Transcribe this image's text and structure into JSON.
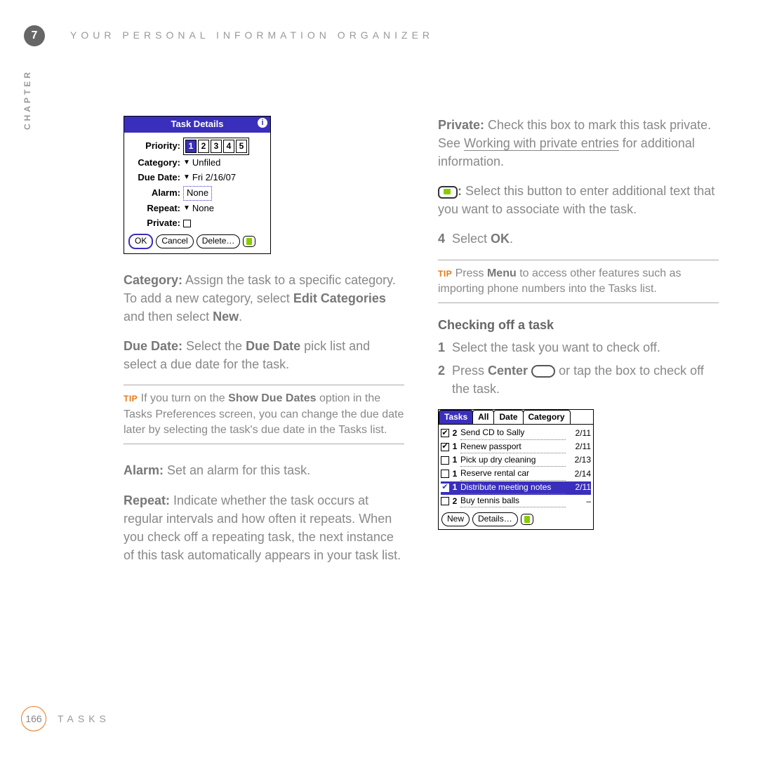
{
  "header": {
    "chapter_num": "7",
    "title": "YOUR PERSONAL INFORMATION ORGANIZER",
    "chapter_word": "CHAPTER"
  },
  "footer": {
    "page_num": "166",
    "section": "TASKS"
  },
  "dialog": {
    "title": "Task Details",
    "priority_label": "Priority:",
    "priority_options": [
      "1",
      "2",
      "3",
      "4",
      "5"
    ],
    "priority_selected": "1",
    "category_label": "Category:",
    "category_value": "Unfiled",
    "duedate_label": "Due Date:",
    "duedate_value": "Fri 2/16/07",
    "alarm_label": "Alarm:",
    "alarm_value": "None",
    "repeat_label": "Repeat:",
    "repeat_value": "None",
    "private_label": "Private:",
    "ok": "OK",
    "cancel": "Cancel",
    "delete": "Delete…"
  },
  "left": {
    "p1_bold": "Category:",
    "p1_rest": " Assign the task to a specific category. To add a new category, select ",
    "p1_bold2": "Edit Categories",
    "p1_mid": " and then select ",
    "p1_bold3": "New",
    "p1_end": ".",
    "p2_bold": "Due Date:",
    "p2_mid": " Select the ",
    "p2_bold2": "Due Date",
    "p2_rest": " pick list and select a due date for the task.",
    "tip_prefix": "TIP",
    "tip_text1": " If you turn on the ",
    "tip_bold": "Show Due Dates",
    "tip_text2": " option in the Tasks Preferences screen, you can change the due date later by selecting the task's due date in the Tasks list.",
    "p3_bold": "Alarm:",
    "p3_rest": " Set an alarm for this task.",
    "p4_bold": "Repeat:",
    "p4_rest": " Indicate whether the task occurs at regular intervals and how often it repeats. When you check off a repeating task, the next instance of this task automatically appears in your task list."
  },
  "right": {
    "p1_bold": "Private:",
    "p1_text": " Check this box to mark this task private. See ",
    "p1_link": "Working with private entries",
    "p1_end": " for additional information.",
    "p2_bold": ":",
    "p2_text": " Select this button to enter additional text that you want to associate with the task.",
    "step4_num": "4",
    "step4_a": "Select ",
    "step4_bold": "OK",
    "step4_end": ".",
    "tip_prefix": "TIP",
    "tip_text1": " Press ",
    "tip_bold": "Menu",
    "tip_text2": " to access other features such as importing phone numbers into the Tasks list.",
    "section": "Checking off a task",
    "s1_num": "1",
    "s1": "Select the task you want to check off.",
    "s2_num": "2",
    "s2_a": "Press ",
    "s2_bold": "Center",
    "s2_b": " or tap the box to check off the task."
  },
  "tasks_app": {
    "title": "Tasks",
    "tab_all": "All",
    "tab_date": "Date",
    "tab_category": "Category",
    "rows": [
      {
        "checked": true,
        "priority": "2",
        "name": "Send CD to Sally",
        "date": "2/11",
        "selected": false
      },
      {
        "checked": true,
        "priority": "1",
        "name": "Renew passport",
        "date": "2/11",
        "selected": false
      },
      {
        "checked": false,
        "priority": "1",
        "name": "Pick up dry cleaning",
        "date": "2/13",
        "selected": false
      },
      {
        "checked": false,
        "priority": "1",
        "name": "Reserve rental car",
        "date": "2/14",
        "selected": false
      },
      {
        "checked": true,
        "priority": "1",
        "name": "Distribute meeting notes",
        "date": "2/11",
        "selected": true
      },
      {
        "checked": false,
        "priority": "2",
        "name": "Buy tennis balls",
        "date": "–",
        "selected": false
      }
    ],
    "new_btn": "New",
    "details_btn": "Details…"
  }
}
